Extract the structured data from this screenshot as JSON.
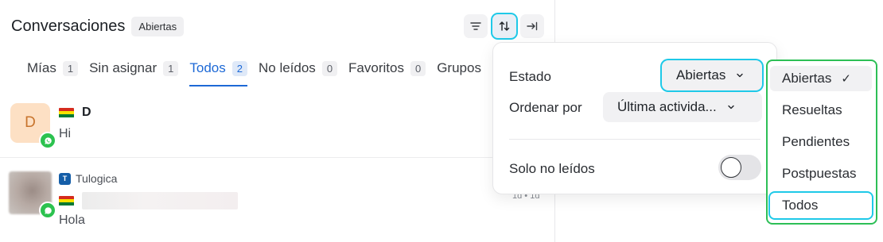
{
  "header": {
    "title": "Conversaciones",
    "status": "Abiertas"
  },
  "toolbar": {
    "filter_icon": "filter-icon",
    "sort_icon": "sort-icon",
    "collapse_icon": "collapse-icon"
  },
  "tabs": [
    {
      "label": "Mías",
      "count": "1"
    },
    {
      "label": "Sin asignar",
      "count": "1"
    },
    {
      "label": "Todos",
      "count": "2"
    },
    {
      "label": "No leídos",
      "count": "0"
    },
    {
      "label": "Favoritos",
      "count": "0"
    },
    {
      "label": "Grupos",
      "count": ""
    }
  ],
  "conversations": [
    {
      "initial": "D",
      "name": "D",
      "message": "Hi",
      "channel": "whatsapp"
    },
    {
      "inbox_initial": "T",
      "inbox": "Tulogica",
      "message": "Hola",
      "time": "1d • 1d",
      "channel": "whatsapp"
    }
  ],
  "popover": {
    "estado_label": "Estado",
    "estado_value": "Abiertas",
    "orden_label": "Ordenar por",
    "orden_value": "Última activida...",
    "solo_label": "Solo no leídos",
    "solo_value": false
  },
  "dropdown": {
    "items": [
      "Abiertas",
      "Resueltas",
      "Pendientes",
      "Postpuestas",
      "Todos"
    ],
    "check": "✓"
  },
  "colors": {
    "accent": "#1d69d6",
    "highlight": "#1ec9e8",
    "green_frame": "#2dbf56",
    "whatsapp": "#2cc24f"
  }
}
